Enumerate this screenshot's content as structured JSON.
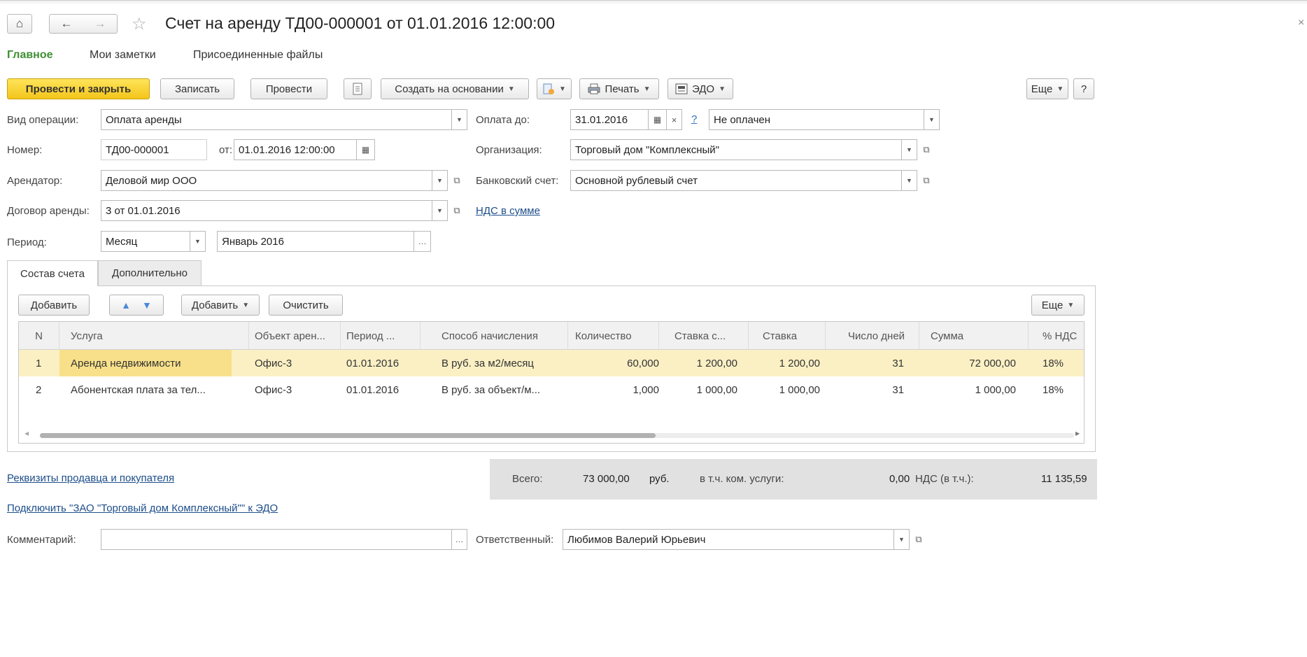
{
  "window": {
    "title": "Счет на аренду ТД00-000001 от 01.01.2016 12:00:00",
    "close": "×"
  },
  "nav": {
    "home": "⌂",
    "back": "←",
    "forward": "→",
    "star": "☆"
  },
  "sections": [
    "Главное",
    "Мои заметки",
    "Присоединенные файлы"
  ],
  "toolbar": {
    "post_close": "Провести и закрыть",
    "save": "Записать",
    "post": "Провести",
    "create_based": "Создать на основании",
    "print": "Печать",
    "edo": "ЭДО",
    "more": "Еще",
    "help": "?"
  },
  "form": {
    "op_type_label": "Вид операции:",
    "op_type": "Оплата аренды",
    "number_label": "Номер:",
    "number": "ТД00-000001",
    "from_label": "от:",
    "date": "01.01.2016 12:00:00",
    "tenant_label": "Арендатор:",
    "tenant": "Деловой мир ООО",
    "contract_label": "Договор аренды:",
    "contract": "3 от 01.01.2016",
    "period_label": "Период:",
    "period_type": "Месяц",
    "period": "Январь 2016",
    "pay_until_label": "Оплата до:",
    "pay_until": "31.01.2016",
    "question": "?",
    "clear": "×",
    "pay_status": "Не оплачен",
    "org_label": "Организация:",
    "org": "Торговый дом \"Комплексный\"",
    "bank_label": "Банковский счет:",
    "bank": "Основной рублевый счет",
    "vat_link": "НДС в сумме"
  },
  "tabs": [
    "Состав счета",
    "Дополнительно"
  ],
  "table_toolbar": {
    "add": "Добавить",
    "add_menu": "Добавить",
    "clear": "Очистить",
    "more": "Еще"
  },
  "table": {
    "columns": [
      "N",
      "Услуга",
      "Объект арен...",
      "Период ...",
      "Способ начисления",
      "Количество",
      "Ставка с...",
      "Ставка",
      "Число дней",
      "Сумма",
      "% НДС"
    ],
    "rows": [
      [
        "1",
        "Аренда недвижимости",
        "Офис-3",
        "01.01.2016",
        "В руб. за м2/месяц",
        "60,000",
        "1 200,00",
        "1 200,00",
        "31",
        "72 000,00",
        "18%"
      ],
      [
        "2",
        "Абонентская плата за тел...",
        "Офис-3",
        "01.01.2016",
        "В руб. за объект/м...",
        "1,000",
        "1 000,00",
        "1 000,00",
        "31",
        "1 000,00",
        "18%"
      ]
    ]
  },
  "totals": {
    "total_label": "Всего:",
    "total": "73 000,00",
    "currency": "руб.",
    "utilities_label": "в т.ч. ком. услуги:",
    "utilities": "0,00",
    "vat_label": "НДС (в т.ч.):",
    "vat": "11 135,59"
  },
  "links": {
    "requisites": "Реквизиты продавца и покупателя",
    "connect_edo": "Подключить \"ЗАО \"Торговый дом Комплексный\"\" к ЭДО"
  },
  "footer": {
    "comment_label": "Комментарий:",
    "comment": "",
    "responsible_label": "Ответственный:",
    "responsible": "Любимов Валерий Юрьевич"
  }
}
